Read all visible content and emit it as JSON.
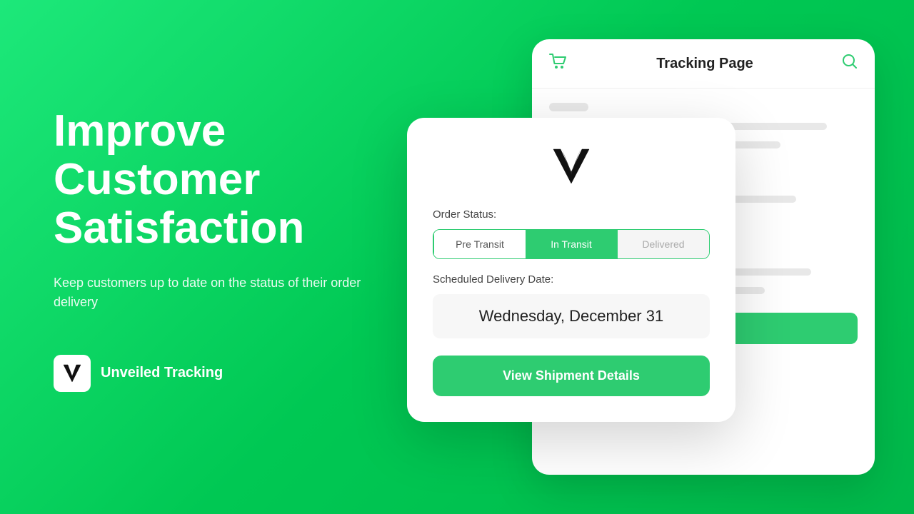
{
  "background": {
    "gradient_start": "#1de87a",
    "gradient_end": "#00b84a"
  },
  "left": {
    "headline": "Improve Customer Satisfaction",
    "subtitle": "Keep customers up to date on the status of their order delivery",
    "brand_name": "Unveiled Tracking"
  },
  "tracking_page_bg": {
    "title": "Tracking Page"
  },
  "modal": {
    "order_status_label": "Order Status:",
    "tabs": [
      {
        "label": "Pre Transit",
        "state": "outline"
      },
      {
        "label": "In Transit",
        "state": "active"
      },
      {
        "label": "Delivered",
        "state": "grey"
      }
    ],
    "delivery_label": "Scheduled Delivery Date:",
    "delivery_date": "Wednesday, December 31",
    "cta_button": "View Shipment Details"
  },
  "icons": {
    "cart": "🛒",
    "search": "🔍",
    "v_letter": "V"
  }
}
